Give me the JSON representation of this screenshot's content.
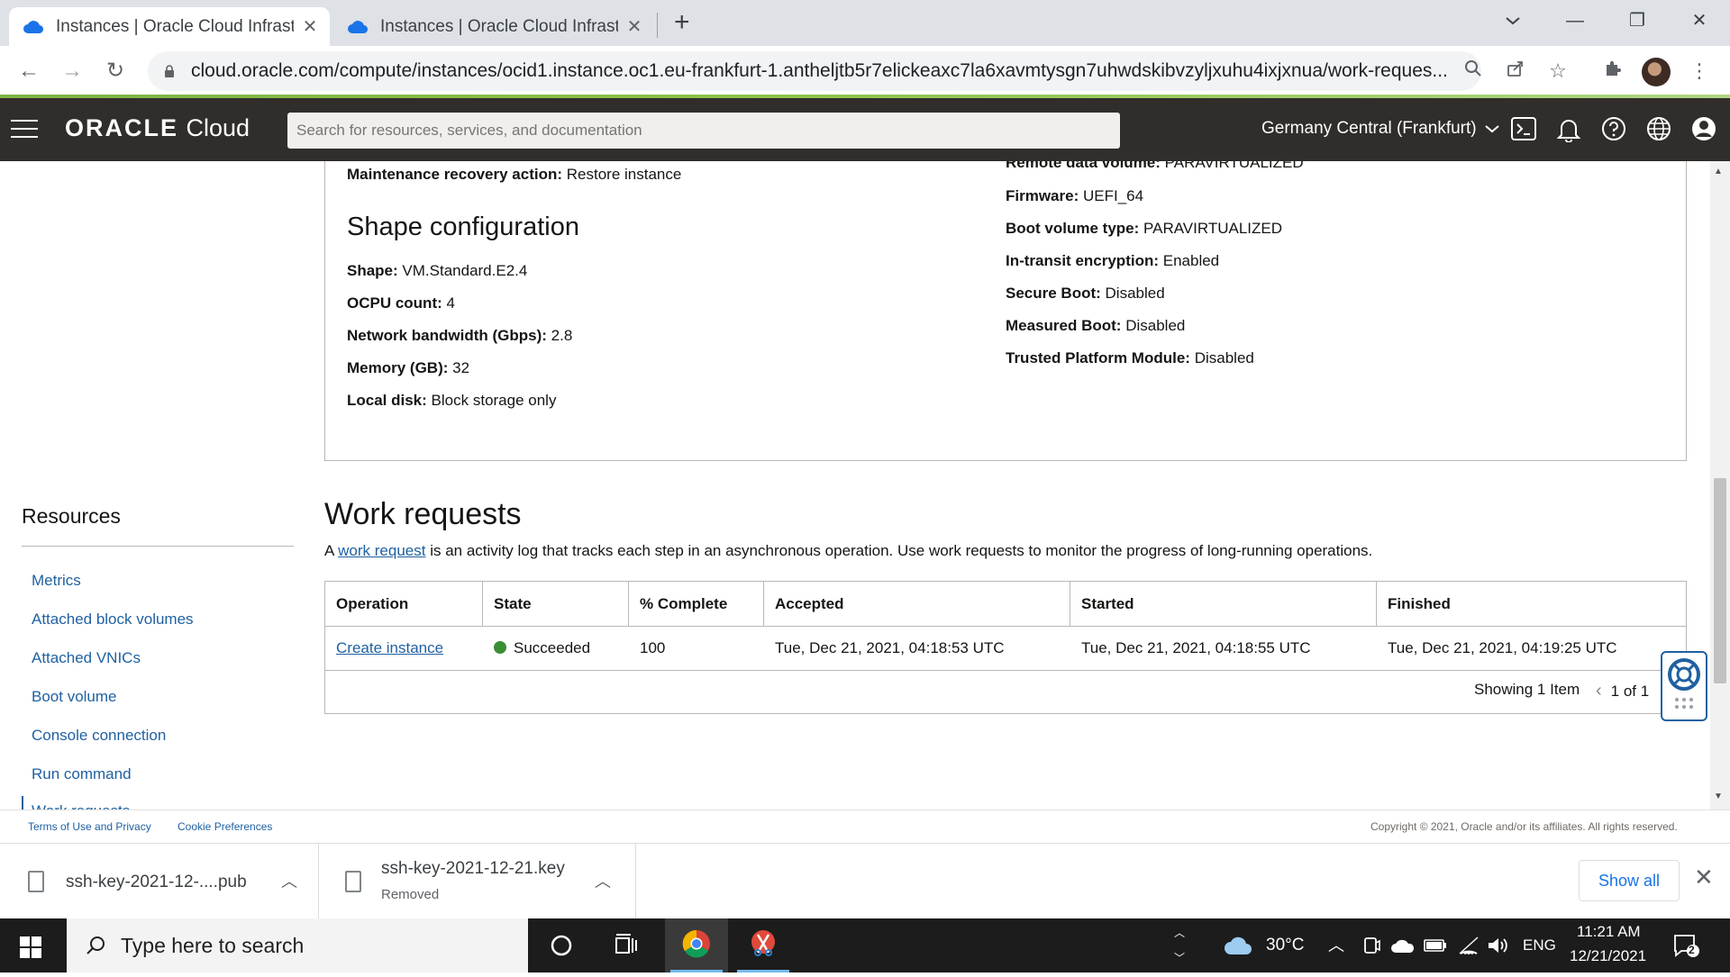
{
  "browser": {
    "tabs": [
      {
        "title": "Instances | Oracle Cloud Infrastructure",
        "active": true
      },
      {
        "title": "Instances | Oracle Cloud Infrastructure",
        "active": false
      }
    ],
    "url": "cloud.oracle.com/compute/instances/ocid1.instance.oc1.eu-frankfurt-1.antheljtb5r7elickeaxc7la6xavmtysgn7uhwdskibvzyljxuhu4ixjxnua/work-reques..."
  },
  "header": {
    "logo_bold": "ORACLE",
    "logo_light": "Cloud",
    "search_placeholder": "Search for resources, services, and documentation",
    "region": "Germany Central (Frankfurt)"
  },
  "instance_details": {
    "left": [
      {
        "label": "Maintenance recovery action:",
        "value": "Restore instance"
      }
    ],
    "shape_heading": "Shape configuration",
    "shape": [
      {
        "label": "Shape:",
        "value": "VM.Standard.E2.4"
      },
      {
        "label": "OCPU count:",
        "value": "4"
      },
      {
        "label": "Network bandwidth (Gbps):",
        "value": "2.8"
      },
      {
        "label": "Memory (GB):",
        "value": "32"
      },
      {
        "label": "Local disk:",
        "value": "Block storage only"
      }
    ],
    "right": [
      {
        "label": "Remote data volume:",
        "value": "PARAVIRTUALIZED"
      },
      {
        "label": "Firmware:",
        "value": "UEFI_64"
      },
      {
        "label": "Boot volume type:",
        "value": "PARAVIRTUALIZED"
      },
      {
        "label": "In-transit encryption:",
        "value": "Enabled"
      },
      {
        "label": "Secure Boot:",
        "value": "Disabled"
      },
      {
        "label": "Measured Boot:",
        "value": "Disabled"
      },
      {
        "label": "Trusted Platform Module:",
        "value": "Disabled"
      }
    ]
  },
  "resources": {
    "title": "Resources",
    "items": [
      "Metrics",
      "Attached block volumes",
      "Attached VNICs",
      "Boot volume",
      "Console connection",
      "Run command",
      "Work requests"
    ]
  },
  "work_requests": {
    "title": "Work requests",
    "desc_prefix": "A",
    "desc_link": "work request",
    "desc_suffix": "is an activity log that tracks each step in an asynchronous operation. Use work requests to monitor the progress of long-running operations.",
    "columns": [
      "Operation",
      "State",
      "% Complete",
      "Accepted",
      "Started",
      "Finished"
    ],
    "rows": [
      {
        "operation": "Create instance",
        "state": "Succeeded",
        "complete": "100",
        "accepted": "Tue, Dec 21, 2021, 04:18:53 UTC",
        "started": "Tue, Dec 21, 2021, 04:18:55 UTC",
        "finished": "Tue, Dec 21, 2021, 04:19:25 UTC"
      }
    ],
    "showing": "Showing 1 Item",
    "page": "1 of 1"
  },
  "footer": {
    "terms": "Terms of Use and Privacy",
    "cookies": "Cookie Preferences",
    "copyright": "Copyright © 2021, Oracle and/or its affiliates. All rights reserved."
  },
  "downloads": {
    "items": [
      {
        "name": "ssh-key-2021-12-....pub",
        "status": ""
      },
      {
        "name": "ssh-key-2021-12-21.key",
        "status": "Removed"
      }
    ],
    "show_all": "Show all"
  },
  "taskbar": {
    "search_placeholder": "Type here to search",
    "temperature": "30°C",
    "language": "ENG",
    "time": "11:21 AM",
    "date": "12/21/2021",
    "notification_count": "2"
  },
  "colors": {
    "oci_header": "#312d2a",
    "link": "#1f61a1",
    "success": "#3a8e34"
  }
}
